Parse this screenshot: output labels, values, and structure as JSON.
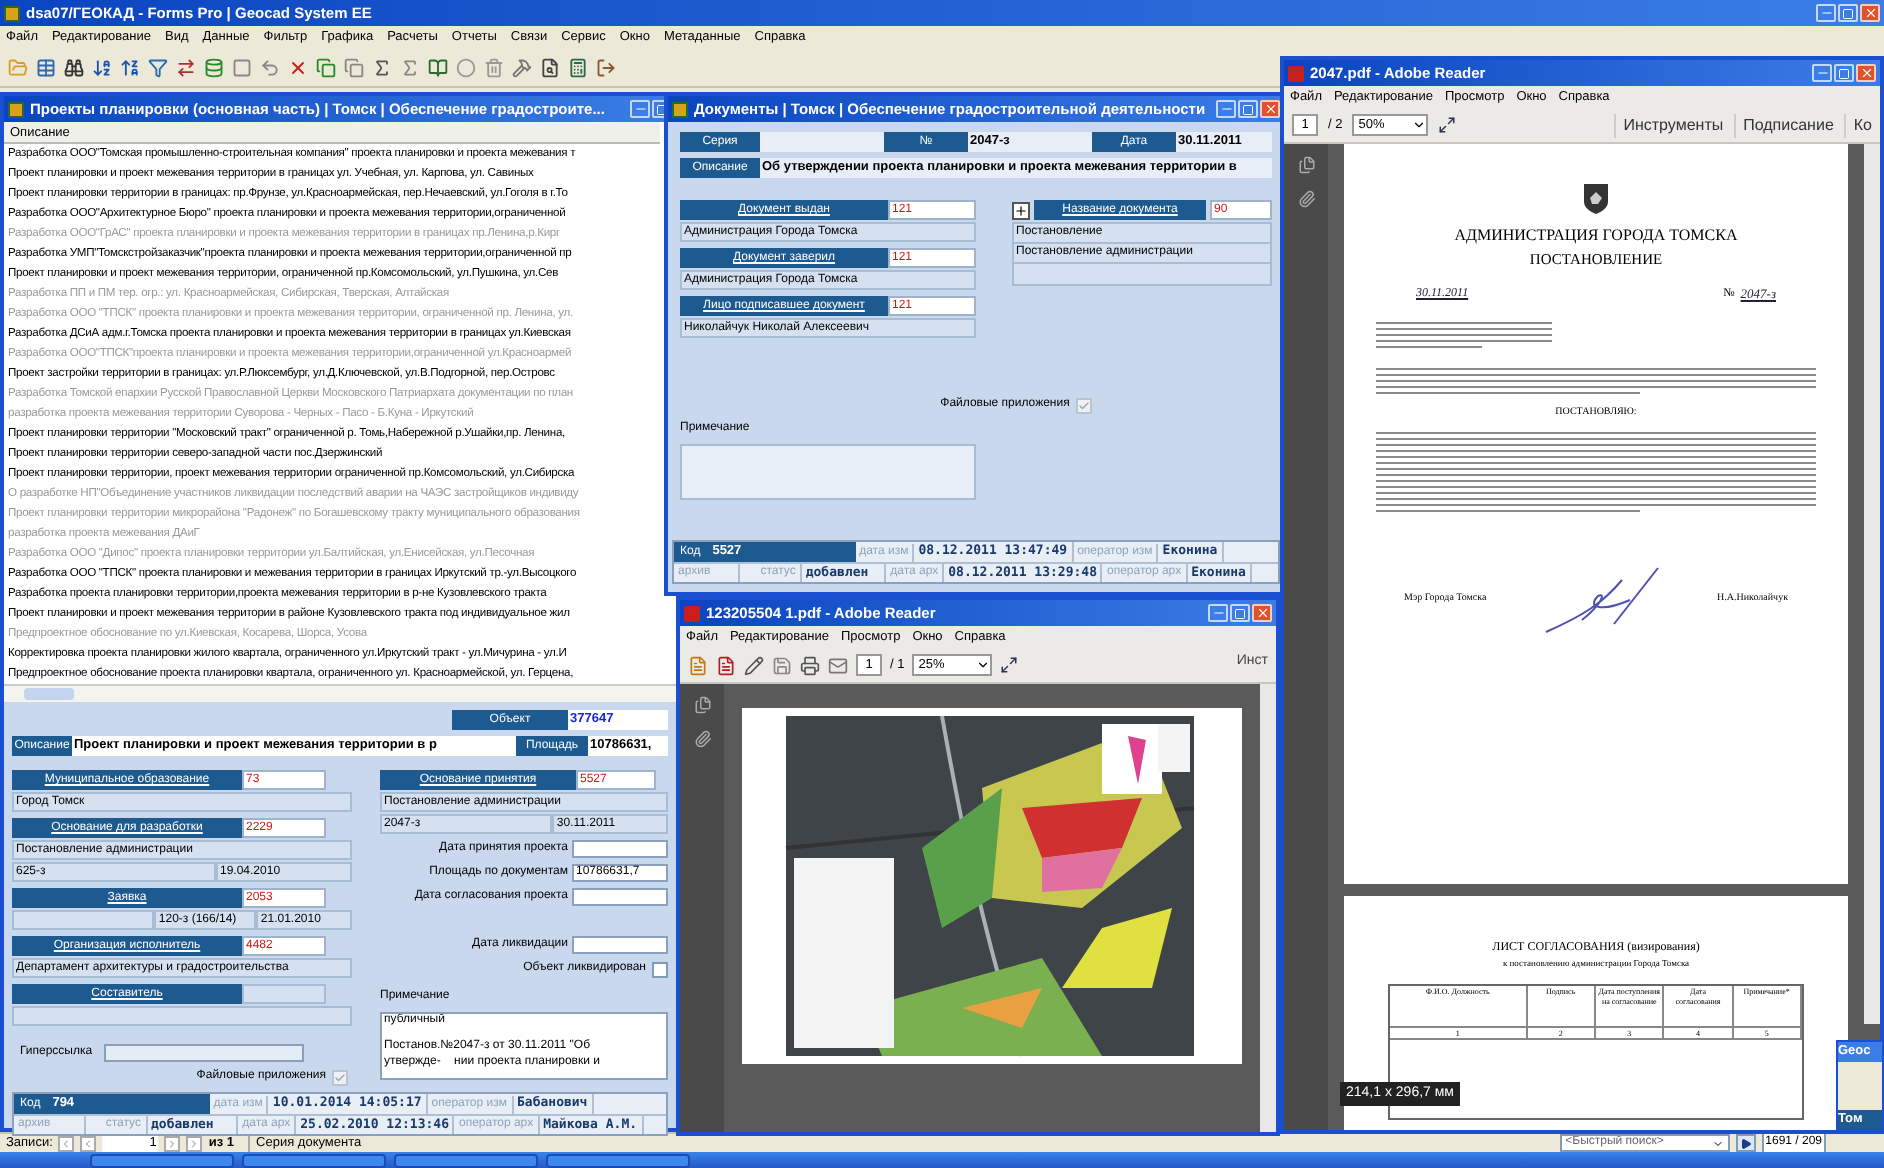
{
  "app": {
    "title": "dsa07/ГЕОКАД - Forms Pro | Geocad System EE",
    "menu": [
      "Файл",
      "Редактирование",
      "Вид",
      "Данные",
      "Фильтр",
      "Графика",
      "Расчеты",
      "Отчеты",
      "Связи",
      "Сервис",
      "Окно",
      "Метаданные",
      "Справка"
    ]
  },
  "projects_window": {
    "title": "Проекты планировки (основная часть) | Томск | Обеспечение градостроите...",
    "column": "Описание",
    "rows": [
      {
        "text": "Разработка ООО\"Томская промышленно-строительная компания\" проекта планировки и проекта межевания т",
        "dimmed": false
      },
      {
        "text": "Проект планировки и проект межевания территории в границах ул. Учебная, ул. Карпова, ул. Савиных",
        "dimmed": false
      },
      {
        "text": "Проект планировки территории в границах: пр.Фрунзе, ул.Красноармейская, пер.Нечаевский, ул.Гоголя в г.То",
        "dimmed": false
      },
      {
        "text": "Разработка ООО\"Архитектурное Бюро\" проекта планировки и проекта межевания территории,ограниченной",
        "dimmed": false
      },
      {
        "text": "Разработка ООО\"ГрАС\" проекта планировки и проекта межевания территории в границах пр.Ленина,р.Кирг",
        "dimmed": true
      },
      {
        "text": "Разработка УМП\"Томскстройзаказчик\"проекта планировки и проекта межевания территории,ограниченной пр",
        "dimmed": false
      },
      {
        "text": "Проект планировки и проект межевания территории, ограниченной пр.Комсомольский, ул.Пушкина, ул.Сев",
        "dimmed": false
      },
      {
        "text": "Разработка ПП и ПМ тер. огр.: ул. Красноармейская, Сибирская, Тверская, Алтайская",
        "dimmed": true
      },
      {
        "text": "Разработка ООО \"ТПСК\" проекта планировки и проекта межевания территории, ограниченной пр. Ленина, ул.",
        "dimmed": true
      },
      {
        "text": "Разработка ДСиА адм.г.Томска проекта планировки и проекта межевания территории в границах ул.Киевская",
        "dimmed": false
      },
      {
        "text": "Разработка ООО\"ТПСК\"проекта планировки и проекта межевания территории,ограниченной ул.Красноармей",
        "dimmed": true
      },
      {
        "text": "Проект застройки территории в границах: ул.Р.Люксембург, ул.Д.Ключевской, ул.В.Подгорной, пер.Островс",
        "dimmed": false
      },
      {
        "text": "Разработка Томской епархии Русской Православной Церкви Московского Патриархата документации по план",
        "dimmed": true
      },
      {
        "text": "разработка проекта межевания территории Суворова - Черных - Пасо - Б.Куна - Иркутский",
        "dimmed": true
      },
      {
        "text": "Проект планировки территории \"Московский тракт\" ограниченной р. Томь,Набережной р.Ушайки,пр. Ленина,",
        "dimmed": false
      },
      {
        "text": "Проект планировки территории северо-западной части пос.Дзержинский",
        "dimmed": false
      },
      {
        "text": "Проект планировки территории, проект межевания территории ограниченной пр.Комсомольский, ул.Сибирска",
        "dimmed": false
      },
      {
        "text": "О разработке НП\"Объединение участников ликвидации последствий аварии на ЧАЭС застройщиков индивиду",
        "dimmed": true
      },
      {
        "text": "Проект планировки территории микрорайона \"Радонеж\" по Богашевскому тракту муниципального образования",
        "dimmed": true
      },
      {
        "text": "разработка проекта межевания ДАиГ",
        "dimmed": true
      },
      {
        "text": "Разработка ООО \"Дипос\" проекта планировки территории ул.Балтийская, ул.Енисейская, ул.Песочная",
        "dimmed": true
      },
      {
        "text": "Разработка ООО \"ТПСК\" проекта планировки и межевания территории в границах Иркутский тр.-ул.Высоцкого",
        "dimmed": false
      },
      {
        "text": "Разработка проекта планировки территории,проекта межевания территории в р-не Кузовлевского тракта",
        "dimmed": false
      },
      {
        "text": "Проект планировки и проект межевания территории в районе Кузовлевского тракта под индивидуальное жил",
        "dimmed": false
      },
      {
        "text": "Предпроектное обоснование по ул.Киевская, Косарева, Шорса, Усова",
        "dimmed": true
      },
      {
        "text": "Корректировка проекта планировки жилого квартала, ограниченного ул.Иркутский тракт - ул.Мичурина - ул.И",
        "dimmed": false
      },
      {
        "text": "Предпроектное обоснование проекта планировки квартала, ограниченного ул. Красноармейской, ул. Герцена,",
        "dimmed": false
      }
    ],
    "form": {
      "object_label": "Объект",
      "object_value": "377647",
      "description_label": "Описание",
      "description_value": "Проект планировки и проект межевания территории в р",
      "area_label": "Площадь",
      "area_value": "10786631,",
      "left": [
        {
          "label": "Муниципальное образование",
          "code": "73",
          "lines": [
            {
              "kind": "full",
              "cells": [
                "Город Томск"
              ]
            }
          ]
        },
        {
          "label": "Основание для разработки",
          "code": "2229",
          "lines": [
            {
              "kind": "full",
              "cells": [
                "Постановление администрации"
              ]
            },
            {
              "kind": "split",
              "cells": [
                "625-з",
                "19.04.2010"
              ]
            }
          ]
        },
        {
          "label": "Заявка",
          "code": "2053",
          "lines": [
            {
              "kind": "offset",
              "cells": [
                "120-з (166/14)",
                "21.01.2010"
              ]
            }
          ]
        },
        {
          "label": "Организация исполнитель",
          "code": "4482",
          "lines": [
            {
              "kind": "full",
              "cells": [
                "Департамент архитектуры и градостроительства"
              ]
            }
          ]
        },
        {
          "label": "Составитель"
        }
      ],
      "basis": {
        "label": "Основание принятия",
        "code": "5527",
        "lines": [
          {
            "kind": "full",
            "cells": [
              "Постановление администрации"
            ]
          },
          {
            "kind": "split",
            "cells": [
              "2047-з",
              "30.11.2011"
            ]
          }
        ]
      },
      "fields": [
        {
          "label": "Дата принятия проекта"
        },
        {
          "label": "Площадь по документам",
          "value": "10786631,7"
        },
        {
          "label": "Дата согласования проекта"
        }
      ],
      "liquidation_label": "Дата ликвидации",
      "liquidated": {
        "label": "Объект ликвидирован",
        "checked": false
      },
      "hyperlink_label": "Гиперссылка",
      "files": {
        "label": "Файловые приложения",
        "checked": true
      },
      "note_label": "Примечание",
      "note": [
        "публичный",
        "Постанов.№2047-з от 30.11.2011 \"Об",
        "утвержде-    нии проекта планировки и"
      ],
      "status": {
        "code_label": "Код",
        "code": "794",
        "changed_label": "дата изм",
        "changed": "10.01.2014 14:05:17",
        "changed_by_label": "оператор изм",
        "changed_by": "Бабанович",
        "archive_label": "архив",
        "status_label": "статус",
        "status": "добавлен",
        "archived_label": "дата арх",
        "archived": "25.02.2010 12:13:46",
        "archived_by_label": "оператор арх",
        "archived_by": "Майкова А.М."
      }
    }
  },
  "documents_window": {
    "title": "Документы | Томск | Обеспечение градостроительной деятельности",
    "series_label": "Серия",
    "number_label": "№",
    "number": "2047-з",
    "date_label": "Дата",
    "date": "30.11.2011",
    "description_label": "Описание",
    "description": "Об утверждении проекта планировки и проекта межевания территории в",
    "left": [
      {
        "label": "Документ выдан",
        "code": "121",
        "lines": [
          {
            "kind": "full",
            "cells": [
              "Администрация Города Томска"
            ]
          }
        ]
      },
      {
        "label": "Документ заверил",
        "code": "121",
        "lines": [
          {
            "kind": "full",
            "cells": [
              "Администрация Города Томска"
            ]
          }
        ]
      },
      {
        "label": "Лицо подписавшее документ",
        "code": "121",
        "lines": [
          {
            "kind": "full",
            "cells": [
              "Николайчук Николай Алексеевич"
            ]
          }
        ]
      }
    ],
    "doc_name": {
      "label": "Название документа",
      "code": "90",
      "items": [
        "Постановление",
        "Постановление администрации"
      ]
    },
    "files": {
      "label": "Файловые приложения",
      "checked": true
    },
    "note_label": "Примечание",
    "status": {
      "code_label": "Код",
      "code": "5527",
      "changed_label": "дата изм",
      "changed": "08.12.2011 13:47:49",
      "changed_by_label": "оператор изм",
      "changed_by": "Еконина",
      "archive_label": "архив",
      "status_label": "статус",
      "status": "добавлен",
      "archived_label": "дата арх",
      "archived": "08.12.2011 13:29:48",
      "archived_by_label": "оператор арх",
      "archived_by": "Еконина"
    }
  },
  "map_pdf_window": {
    "title": "123205504 1.pdf - Adobe Reader",
    "menu": [
      "Файл",
      "Редактирование",
      "Просмотр",
      "Окно",
      "Справка"
    ],
    "page": "1",
    "pages": "/ 1",
    "zoom": "25%",
    "tools": "Инст"
  },
  "doc_pdf_window": {
    "title": "2047.pdf - Adobe Reader",
    "menu": [
      "Файл",
      "Редактирование",
      "Просмотр",
      "Окно",
      "Справка"
    ],
    "page": "1",
    "pages": "/ 2",
    "zoom": "50%",
    "links": [
      "Инструменты",
      "Подписание",
      "Ко"
    ],
    "page1": {
      "heading": "АДМИНИСТРАЦИЯ ГОРОДА ТОМСКА",
      "subheading": "ПОСТАНОВЛЕНИЕ",
      "date": "30.11.2011",
      "number_sign": "№",
      "number": "2047-з",
      "decree": "ПОСТАНОВЛЯЮ:",
      "signer_title": "Мэр Города Томска",
      "signer": "Н.А.Николайчук"
    },
    "page2": {
      "heading": "ЛИСТ СОГЛАСОВАНИЯ (визирования)",
      "subheading": "к постановлению администрации Города Томска",
      "columns": [
        "Ф.И.О. Должность",
        "Подпись",
        "Дата поступления на согласование",
        "Дата согласования",
        "Примечание*"
      ],
      "numbers": [
        "1",
        "2",
        "3",
        "4",
        "5"
      ]
    },
    "size_badge": "214,1 x 296,7 мм"
  },
  "record_nav": {
    "label": "Записи:",
    "current": "1",
    "total": "из 1",
    "series": "Серия документа"
  },
  "quick_search": {
    "placeholder": "<Быстрый поиск>",
    "counter": "1691 / 209"
  },
  "mini_window": {
    "title": "Geoc",
    "item": "Том"
  }
}
